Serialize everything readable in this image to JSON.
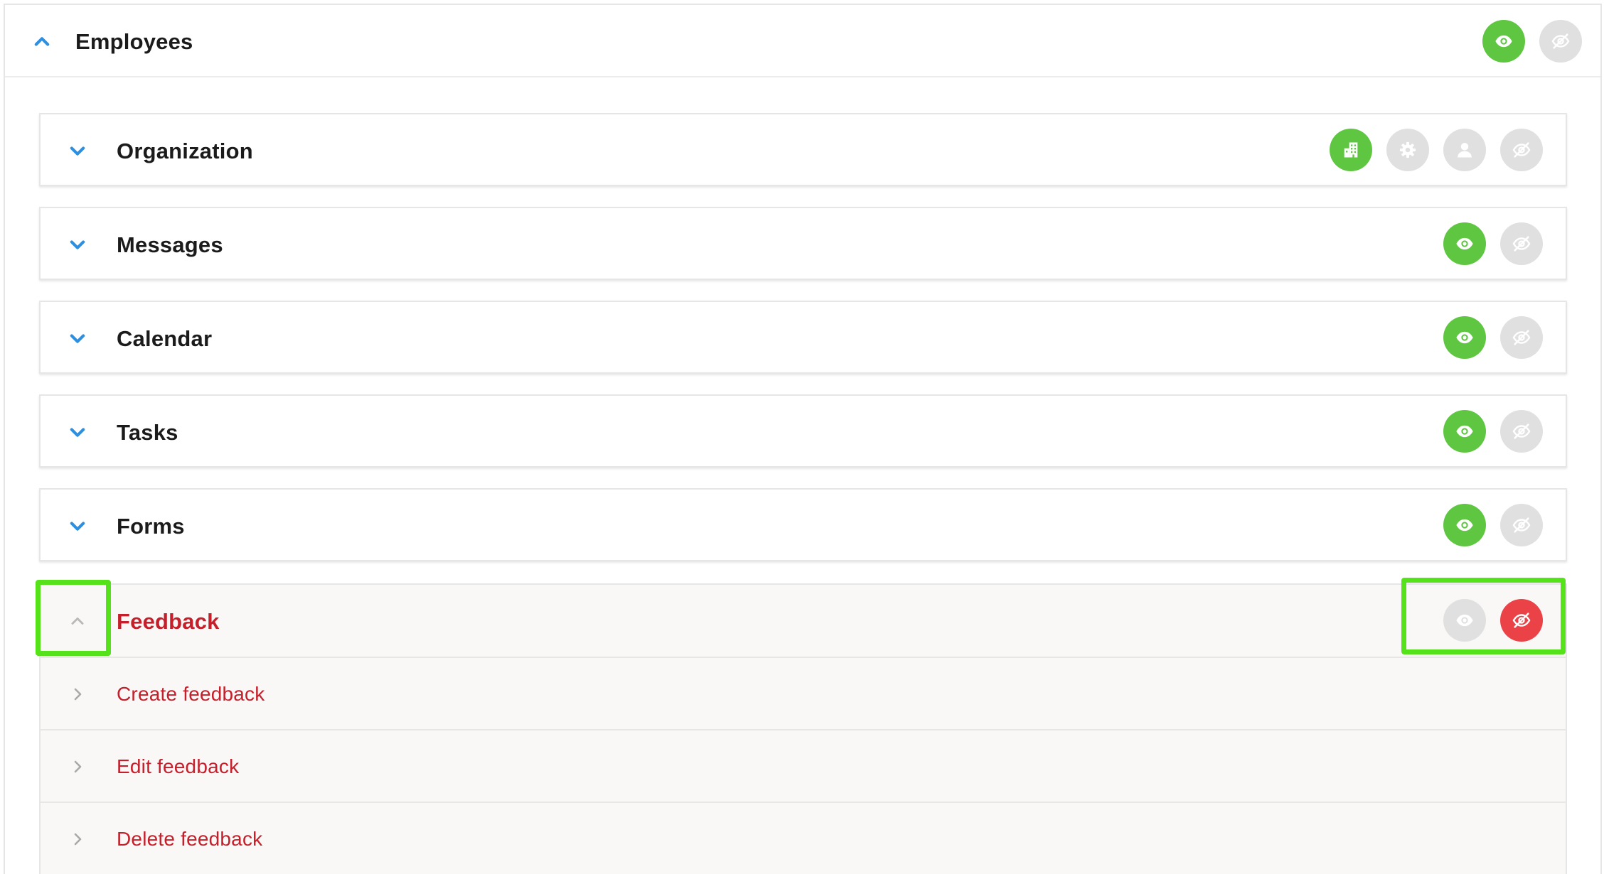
{
  "header": {
    "title": "Employees",
    "collapse_icon": "chevron-up-icon"
  },
  "panels": [
    {
      "title": "Organization",
      "icon": "chevron-down-icon",
      "actions": [
        "building-icon",
        "gear-icon",
        "user-icon",
        "eye-slash-icon"
      ]
    },
    {
      "title": "Messages",
      "icon": "chevron-down-icon",
      "actions": [
        "eye-icon",
        "eye-slash-icon"
      ]
    },
    {
      "title": "Calendar",
      "icon": "chevron-down-icon",
      "actions": [
        "eye-icon",
        "eye-slash-icon"
      ]
    },
    {
      "title": "Tasks",
      "icon": "chevron-down-icon",
      "actions": [
        "eye-icon",
        "eye-slash-icon"
      ]
    },
    {
      "title": "Forms",
      "icon": "chevron-down-icon",
      "actions": [
        "eye-icon",
        "eye-slash-icon"
      ]
    }
  ],
  "feedback": {
    "title": "Feedback",
    "icon": "chevron-up-icon",
    "actions": [
      "eye-icon",
      "eye-slash-icon"
    ],
    "items": [
      {
        "label": "Create feedback"
      },
      {
        "label": "Edit feedback"
      },
      {
        "label": "Delete feedback"
      }
    ]
  },
  "colors": {
    "green": "#5fc641",
    "gray": "#e0e0e0",
    "red": "#ea4247",
    "accent_blue": "#2d8fe0",
    "danger_text": "#c4202b",
    "highlight": "#56e21b"
  }
}
